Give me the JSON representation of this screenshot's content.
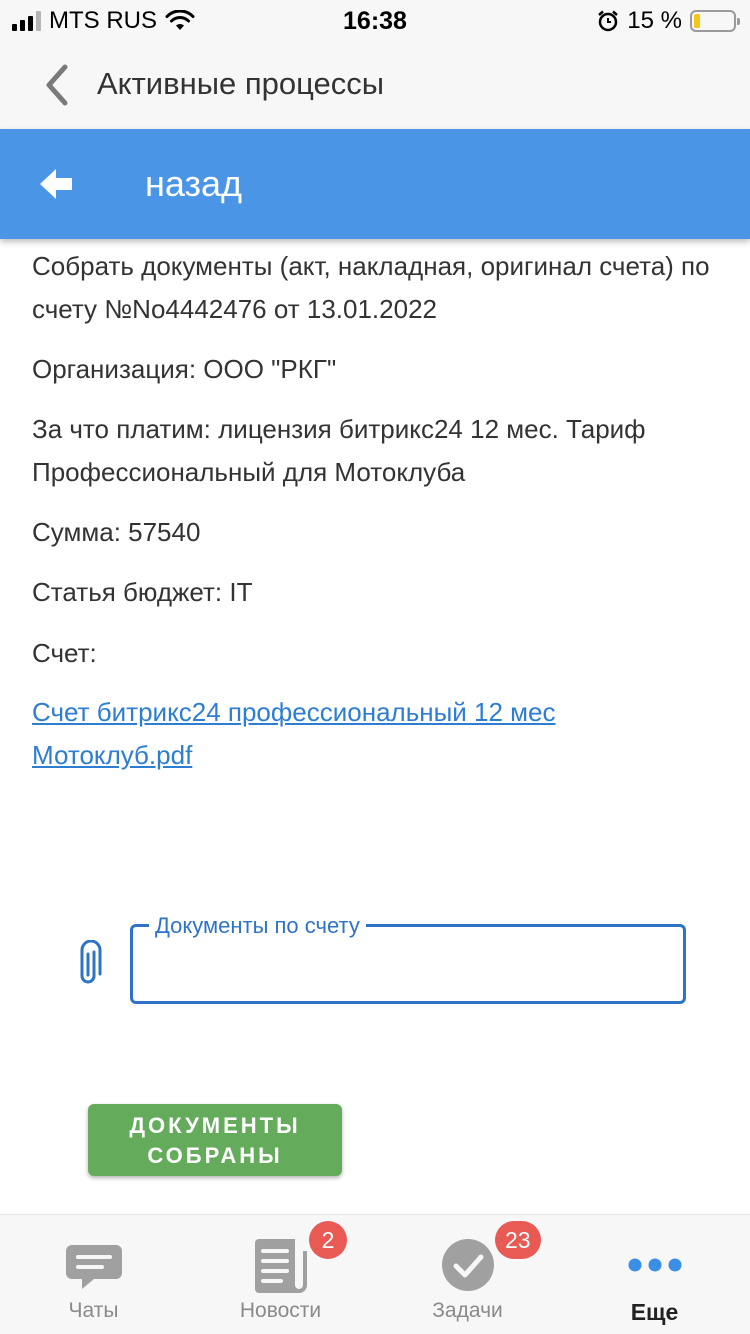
{
  "status_bar": {
    "carrier": "MTS RUS",
    "time": "16:38",
    "battery_percent": "15 %",
    "battery_level": 0.15
  },
  "nav_bar": {
    "title": "Активные процессы"
  },
  "header": {
    "back_label": "назад",
    "color": "#4a95e6"
  },
  "task": {
    "description": "Собрать документы (акт, накладная, оригинал счета) по счету №No4442476 от 13.01.2022",
    "organization": "Организация: ООО \"РКГ\"",
    "purpose": "За что платим: лицензия битрикс24 12 мес. Тариф Профессиональный для Мотоклуба",
    "amount": "Сумма: 57540",
    "budget_item": "Статья бюджет: IT",
    "invoice_label": "Счет:",
    "invoice_file": "Счет битрикс24 профессиональный 12 мес Мотоклуб.pdf"
  },
  "form": {
    "documents_field_label": "Документы по счету",
    "documents_field_value": ""
  },
  "actions": {
    "complete_label": "ДОКУМЕНТЫ СОБРАНЫ",
    "complete_color": "#64ac5c"
  },
  "tab_bar": {
    "tabs": [
      {
        "label": "Чаты",
        "icon": "chat-icon",
        "badge": ""
      },
      {
        "label": "Новости",
        "icon": "news-icon",
        "badge": "2"
      },
      {
        "label": "Задачи",
        "icon": "tasks-icon",
        "badge": "23"
      },
      {
        "label": "Еще",
        "icon": "more-icon",
        "badge": "",
        "active": true
      }
    ]
  }
}
